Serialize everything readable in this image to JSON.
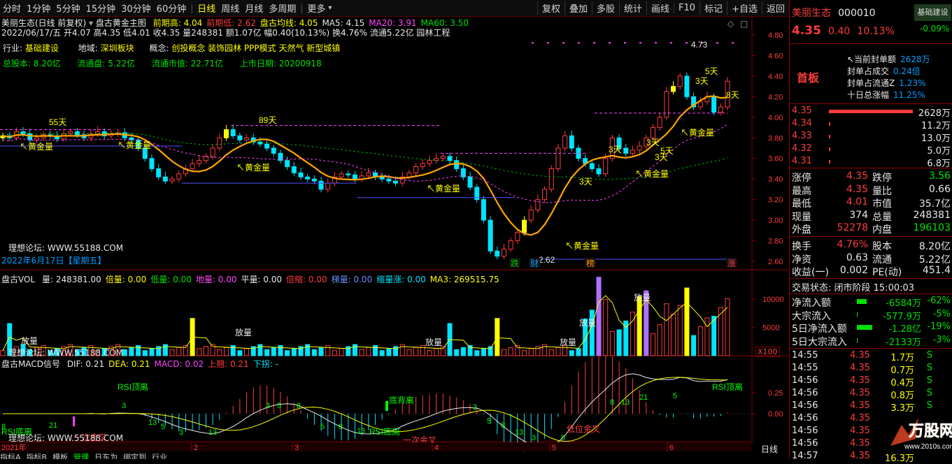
{
  "toolbar": {
    "periods": [
      "分时",
      "1分钟",
      "5分钟",
      "15分钟",
      "30分钟",
      "60分钟",
      "日线",
      "周线",
      "月线",
      "多周期",
      "更多"
    ],
    "active_period": "日线",
    "right_buttons": [
      "复权",
      "叠加",
      "多股",
      "统计",
      "画线",
      "F10",
      "标记",
      "+自选",
      "返回"
    ]
  },
  "main_chart": {
    "title_left": "美丽生态(日线 前复权)",
    "title_indicator": "盘古黄金主图",
    "legend": [
      {
        "label": "前期高: 4.04",
        "color": "#ffff00"
      },
      {
        "label": "前期低: 2.62",
        "color": "#ff3c3c"
      },
      {
        "label": "盘古均线: 4.05",
        "color": "#ffff00"
      },
      {
        "label": "MA5: 4.15",
        "color": "#e8e8e8"
      },
      {
        "label": "MA20: 3.91",
        "color": "#ff44ff"
      },
      {
        "label": "MA60: 3.50",
        "color": "#00e000"
      }
    ],
    "info_line": "2022/06/17/五 开4.07 高4.35 低4.01 收4.35 量248381 额1.07亿 幅0.40(10.13%) 换4.76% 流通5.22亿 园林工程",
    "industry_line": {
      "industry_label": "行业:",
      "industry": "基础建设",
      "region_label": "地域:",
      "region": "深圳板块",
      "concept_label": "概念:",
      "concept": "创投概念 装饰园林 PPP模式 天然气 新型城镇"
    },
    "capital_line": {
      "total": "总股本: 8.20亿",
      "float": "流通盘: 5.22亿",
      "mcap": "流通市值: 22.71亿",
      "listed": "上市日期: 20200918"
    },
    "watermark": "理想论坛: WWW.55188.COM",
    "date_stamp": "2022年6月17日【星期五】",
    "y_ticks": [
      "4.80",
      "4.60",
      "4.40",
      "4.20",
      "4.00",
      "3.80",
      "3.60",
      "3.40",
      "3.20",
      "3.00",
      "2.80",
      "2.60"
    ],
    "annotations": [
      "55天",
      "89天",
      "黄金量",
      "黄金量",
      "黄金量",
      "黄金量",
      "黄金量",
      "黄金量",
      "黄金量",
      "3天",
      "3天",
      "3天",
      "3天",
      "5天",
      "8天",
      "3天",
      "5天",
      "4.73",
      "2.62"
    ],
    "bottom_markers": [
      "跌",
      "财",
      "榜",
      "涨"
    ]
  },
  "volume_chart": {
    "title": "盘古VOL",
    "legend": [
      {
        "label": "量: 248381.00",
        "color": "#e8e8e8"
      },
      {
        "label": "倍量: 0.00",
        "color": "#ffff00"
      },
      {
        "label": "低量: 0.00",
        "color": "#00e000"
      },
      {
        "label": "地量: 0.00",
        "color": "#ff44ff"
      },
      {
        "label": "平量: 0.00",
        "color": "#e8e8e8"
      },
      {
        "label": "倍缩: 0.00",
        "color": "#ff3c3c"
      },
      {
        "label": "梯量: 0.00",
        "color": "#6a8cff"
      },
      {
        "label": "缩量涨: 0.00",
        "color": "#00e5ff"
      },
      {
        "label": "MA3: 269515.75",
        "color": "#ffff00"
      }
    ],
    "y_ticks": [
      "10000",
      "5000"
    ],
    "unit": "X100",
    "labels": [
      "放量",
      "放量",
      "放量",
      "放量",
      "放量",
      "放量"
    ],
    "watermark": "理想论坛: WWW.55188.COM"
  },
  "macd_chart": {
    "title": "盘古MACD信号",
    "legend": [
      {
        "label": "DIF: 0.21",
        "color": "#e8e8e8"
      },
      {
        "label": "DEA: 0.21",
        "color": "#ffff00"
      },
      {
        "label": "MACD: 0.02",
        "color": "#ff44ff"
      },
      {
        "label": "上翘: 0.21",
        "color": "#ff3c3c"
      },
      {
        "label": "下拐: -",
        "color": "#00e5ff"
      }
    ],
    "y_ticks": [
      "0.25",
      "0.00"
    ],
    "labels": [
      "RSI顶离",
      "RSI顶离",
      "RSI底离",
      "RSI底离",
      "底背离",
      "低位金叉",
      "一次金叉",
      "一次金叉"
    ],
    "counts": [
      "3",
      "3",
      "5",
      "8",
      "5",
      "13",
      "21",
      "3",
      "5",
      "8",
      "13",
      "3",
      "5",
      "8",
      "13",
      "21",
      "5",
      "8",
      "13",
      "3",
      "5",
      "8",
      "13"
    ],
    "watermark": "理想论坛: WWW.55188.COM"
  },
  "x_axis": {
    "year": "2021年",
    "months": [
      "2",
      "3",
      "4",
      "5",
      "6"
    ]
  },
  "bottom_tabs": [
    "指标A",
    "指标B",
    "模板",
    "管理",
    "日东为",
    "绑定到",
    "行业"
  ],
  "right_label": "日线",
  "sidebar": {
    "stock_name": "美丽生态",
    "stock_code": "000010",
    "sector_badge": "基础建设",
    "sector_change": "-0.09%",
    "price": "4.35",
    "change": "0.40",
    "change_pct": "10.13%",
    "board_label": "首板",
    "seal_info": [
      {
        "label": "当前封单额",
        "value": "2628万"
      },
      {
        "label": "封单占成交",
        "value": "0.24倍"
      },
      {
        "label": "封单占流通Z",
        "value": "1.23%"
      },
      {
        "label": "十日总涨幅",
        "value": "11.25%"
      }
    ],
    "bids": [
      {
        "price": "4.35",
        "vol": "2628万"
      },
      {
        "price": "4.34",
        "vol": "11.2万"
      },
      {
        "price": "4.33",
        "vol": "13.0万"
      },
      {
        "price": "4.32",
        "vol": "5.0万"
      },
      {
        "price": "4.31",
        "vol": "6.8万"
      }
    ],
    "stats": [
      {
        "l1": "涨停",
        "v1": "4.35",
        "l2": "跌停",
        "v2": "3.56"
      },
      {
        "l1": "最高",
        "v1": "4.35",
        "l2": "量比",
        "v2": "0.66"
      },
      {
        "l1": "最低",
        "v1": "4.01",
        "l2": "市值",
        "v2": "35.7亿"
      },
      {
        "l1": "现量",
        "v1": "374",
        "l2": "总量",
        "v2": "248381"
      },
      {
        "l1": "外盘",
        "v1": "52278",
        "l2": "内盘",
        "v2": "196103"
      }
    ],
    "stats2": [
      {
        "l1": "换手",
        "v1": "4.76%",
        "l2": "股本",
        "v2": "8.20亿"
      },
      {
        "l1": "净资",
        "v1": "0.63",
        "l2": "流通",
        "v2": "5.22亿"
      },
      {
        "l1": "收益(一)",
        "v1": "0.002",
        "l2": "PE(动)",
        "v2": "451.4"
      }
    ],
    "trade_state": "交易状态: 闭市阶段 15:00:03",
    "flows": [
      {
        "label": "净流入额",
        "value": "-6584万",
        "pct": "-62%"
      },
      {
        "label": "大宗流入",
        "value": "-577.9万",
        "pct": "-5%"
      },
      {
        "label": "5日净流入额",
        "value": "-1.28亿",
        "pct": "-19%"
      },
      {
        "label": "5日大宗流入",
        "value": "-2133万",
        "pct": "-3%"
      }
    ],
    "ticks": [
      {
        "time": "14:55",
        "price": "4.35",
        "vol": "1.7万",
        "side": "S"
      },
      {
        "time": "14:55",
        "price": "4.35",
        "vol": "0.7万",
        "side": "S"
      },
      {
        "time": "14:56",
        "price": "4.35",
        "vol": "0.4万",
        "side": "S"
      },
      {
        "time": "14:56",
        "price": "4.35",
        "vol": "0.8万",
        "side": "S"
      },
      {
        "time": "14:56",
        "price": "4.35",
        "vol": "3.3万",
        "side": "S"
      },
      {
        "time": "14:56",
        "price": "4.35",
        "vol": "",
        "side": ""
      },
      {
        "time": "14:56",
        "price": "4.35",
        "vol": "",
        "side": ""
      },
      {
        "time": "14:56",
        "price": "4.35",
        "vol": "",
        "side": ""
      },
      {
        "time": "14:57",
        "price": "4.35",
        "vol": "16.3万",
        "side": ""
      }
    ],
    "logo_text": "万股网",
    "logo_url": "www.2010s.com"
  },
  "colors": {
    "up": "#ff3c3c",
    "down": "#00e5ff",
    "ma_gold": "#ffa500",
    "frame": "#8b0000"
  }
}
